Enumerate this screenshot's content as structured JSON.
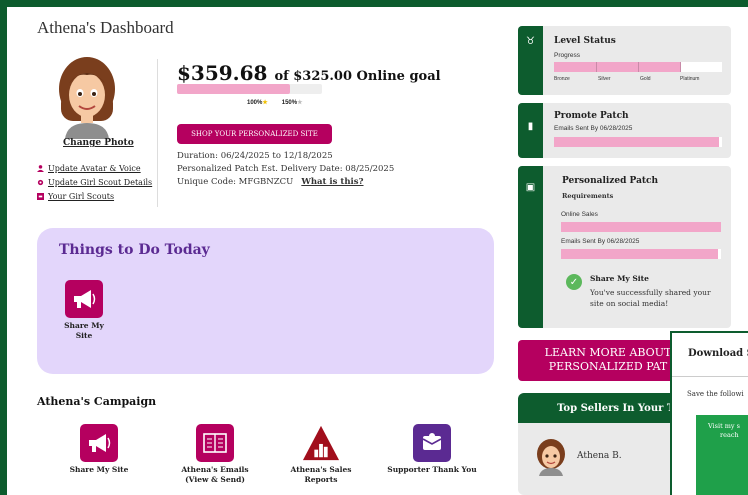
{
  "dashboard": {
    "title": "Athena's Dashboard"
  },
  "profile": {
    "change_photo": "Change Photo",
    "links": [
      {
        "label": "Update Avatar & Voice",
        "icon": "person-icon"
      },
      {
        "label": "Update Girl Scout Details",
        "icon": "gear-icon"
      },
      {
        "label": "Your Girl Scouts",
        "icon": "square-icon"
      }
    ]
  },
  "goal": {
    "amount": "$359.68",
    "goal_text": "of $325.00 Online goal",
    "progress_fraction": 1.0,
    "mark_100": "100%",
    "mark_150": "150%",
    "shop_button": "SHOP YOUR PERSONALIZED SITE",
    "duration": "Duration: 06/24/2025 to 12/18/2025",
    "patch_delivery": "Personalized Patch Est. Delivery Date: 08/25/2025",
    "unique_code": "Unique Code: MFGBNZCU",
    "what_is_this": "What is this?"
  },
  "todo": {
    "title": "Things to Do Today",
    "items": [
      {
        "label": "Share My Site",
        "icon": "megaphone-icon"
      }
    ]
  },
  "campaign": {
    "title": "Athena's Campaign",
    "items": [
      {
        "label": "Share My Site",
        "icon": "megaphone-icon"
      },
      {
        "label": "Athena's Emails (View & Send)",
        "icon": "email-list-icon"
      },
      {
        "label": "Athena's Sales Reports",
        "icon": "bar-chart-icon"
      },
      {
        "label": "Supporter Thank You",
        "icon": "envelope-icon"
      }
    ]
  },
  "level_status": {
    "title": "Level Status",
    "progress_label": "Progress",
    "tiers": [
      "Bronze",
      "Silver",
      "Gold",
      "Platinum"
    ],
    "progress_fraction": 0.75
  },
  "promote_patch": {
    "title": "Promote Patch",
    "sub": "Emails Sent By 06/28/2025",
    "progress_fraction": 0.98
  },
  "personalized_patch": {
    "title": "Personalized Patch",
    "subtitle": "Requirements",
    "online_sales_label": "Online Sales",
    "online_sales_fraction": 1.0,
    "emails_label": "Emails Sent By 06/28/2025",
    "emails_fraction": 0.98,
    "share_title": "Share My Site",
    "share_text": "You've successfully shared your site on social media!"
  },
  "learn_more": {
    "line1": "LEARN MORE ABOUT",
    "line2": "PERSONALIZED PAT"
  },
  "top_sellers": {
    "title": "Top Sellers In Your Tr",
    "seller": "Athena B."
  },
  "modal": {
    "title": "Download S",
    "body": "Save the followi",
    "green_line1": "Visit my s",
    "green_line2": "reach"
  },
  "colors": {
    "brand_green": "#0d5c2e",
    "brand_magenta": "#b5005f",
    "progress_pink": "#f2a6c9",
    "todo_lavender": "#e3d6fb",
    "todo_title_purple": "#5b2a92",
    "check_green": "#5cb85c"
  }
}
